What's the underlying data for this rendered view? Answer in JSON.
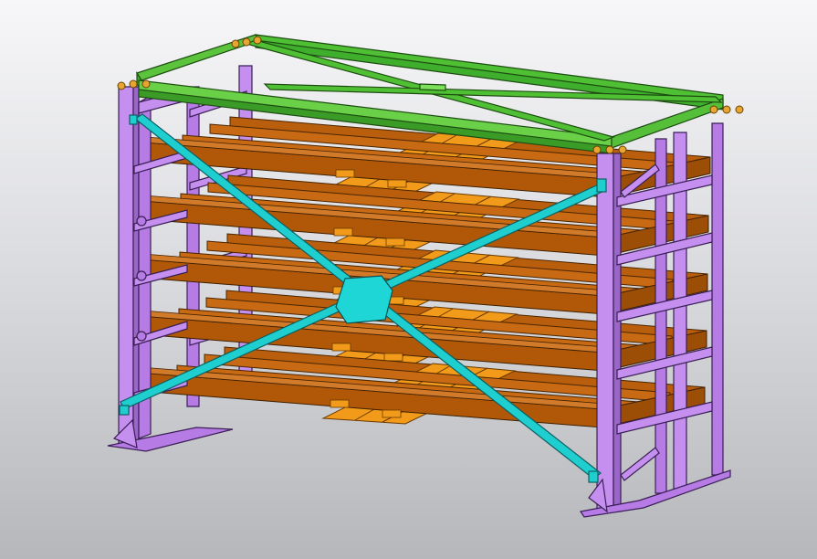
{
  "viewport": {
    "background_top": "#f7f7f9",
    "background_bottom": "#b6b7bb"
  },
  "model": {
    "parts": [
      {
        "name": "frame-uprights",
        "color": "#c58ff0"
      },
      {
        "name": "top-frame",
        "color": "#3fae2c"
      },
      {
        "name": "cross-bracing",
        "color": "#1fcfd0"
      },
      {
        "name": "shelf-rails",
        "color": "#b85e0c"
      },
      {
        "name": "sliding-pallets",
        "color": "#f29a1a"
      },
      {
        "name": "anchor-bolts",
        "color": "#e8a531"
      }
    ],
    "shelf_levels": 5
  }
}
